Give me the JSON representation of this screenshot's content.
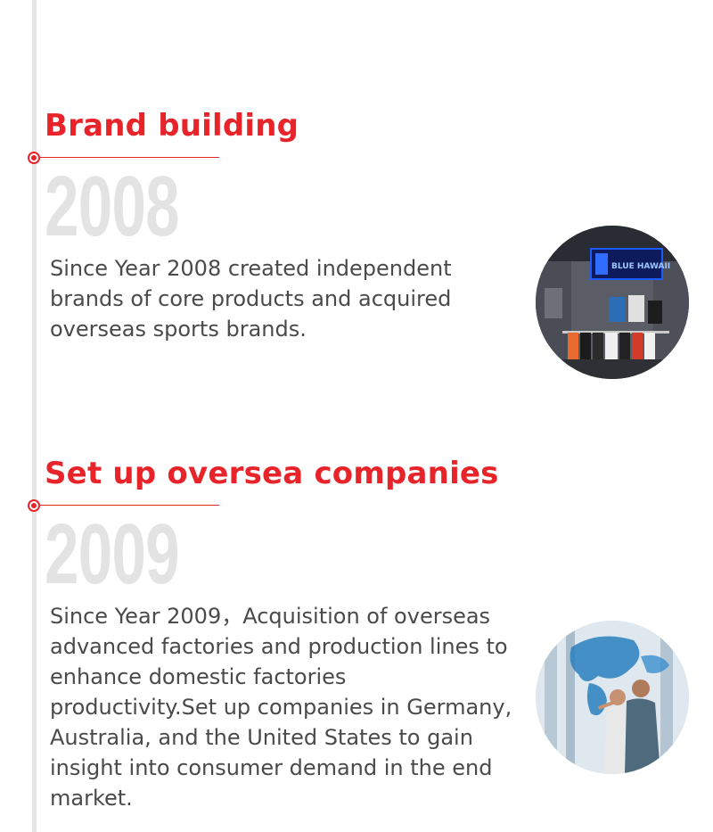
{
  "timeline": {
    "entries": [
      {
        "title": "Brand building",
        "year": "2008",
        "description": "Since Year 2008 created independent brands of core products and acquired overseas sports brands.",
        "image_sign_text": "BLUE HAWAII"
      },
      {
        "title": "Set up oversea companies",
        "year": "2009",
        "description": "Since Year 2009，Acquisition of overseas advanced factories and production lines to enhance domestic factories productivity.Set up companies in Germany, Australia, and the United States to gain insight into consumer demand in the end market."
      }
    ]
  },
  "colors": {
    "accent": "#e8242b",
    "timeline_line": "#e6e6e6",
    "year_text": "#e3e3e3",
    "body_text": "#4a4a4a"
  }
}
